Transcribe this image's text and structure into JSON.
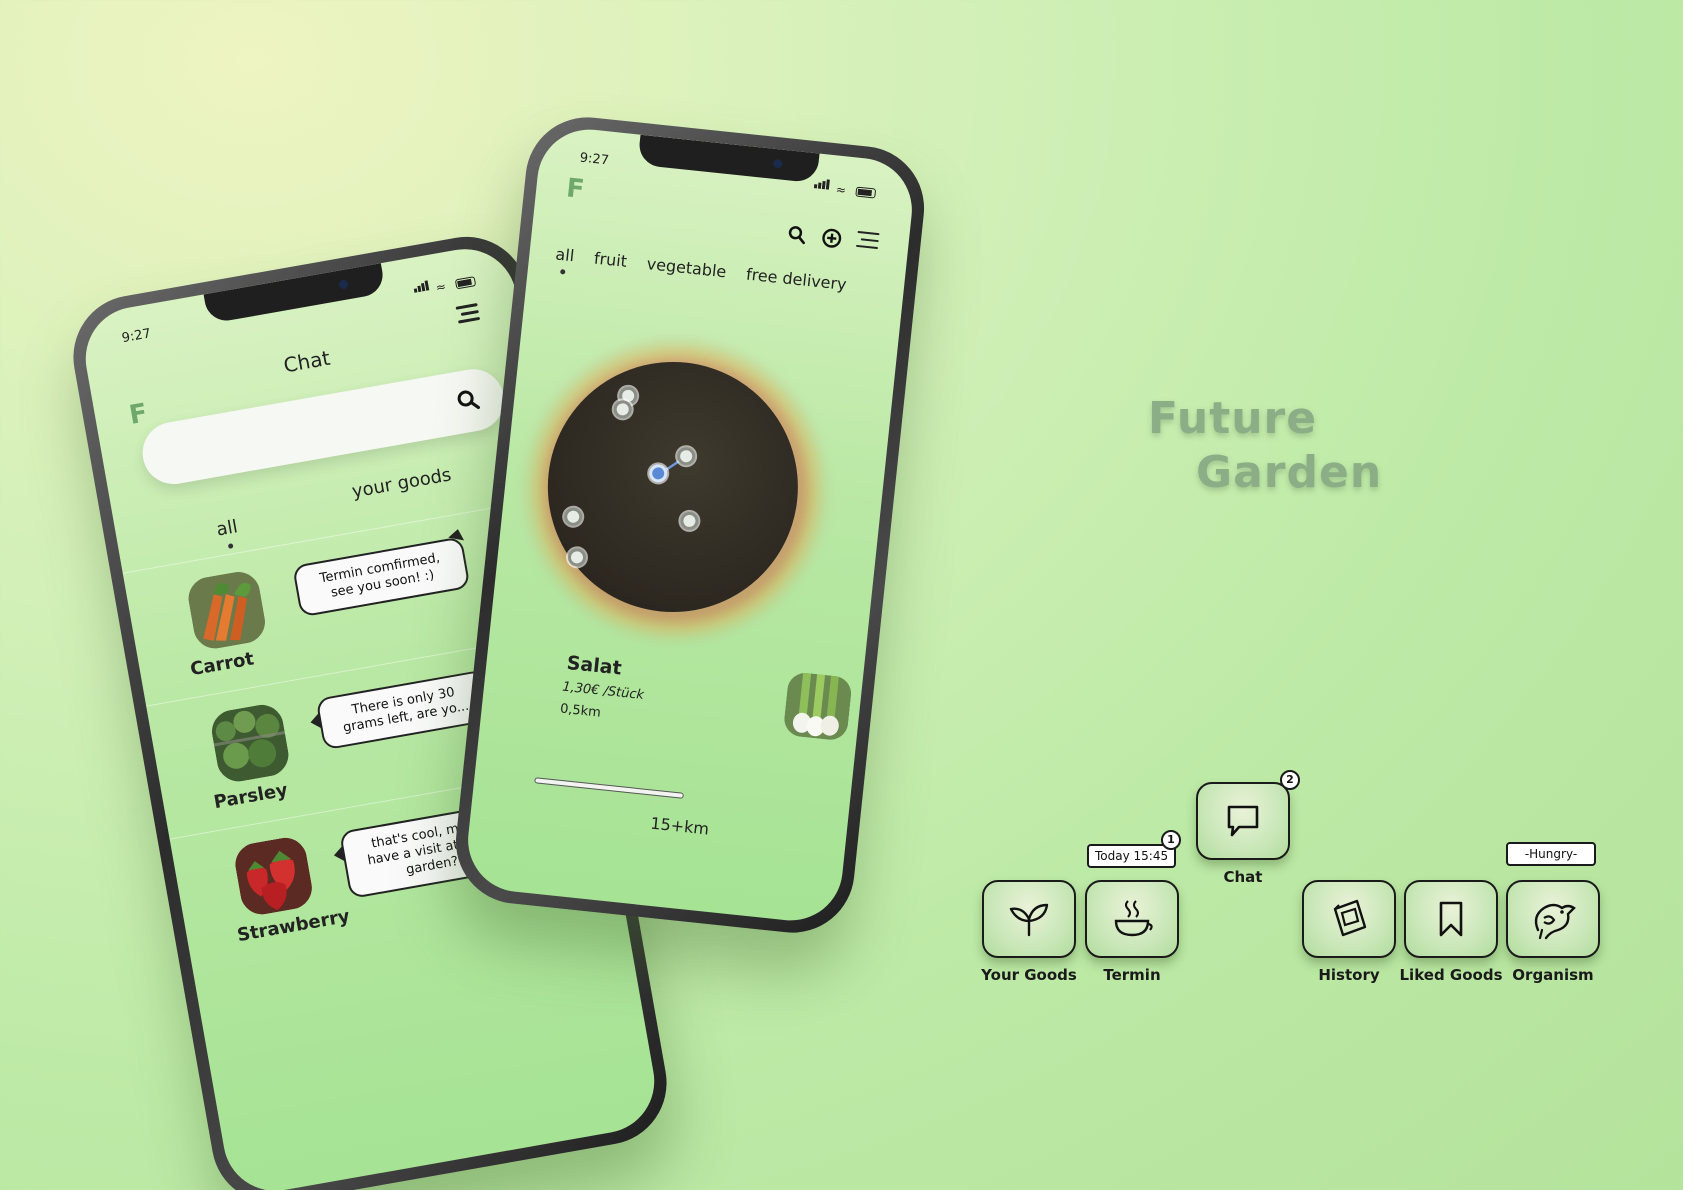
{
  "status": {
    "time": "9:27"
  },
  "brand": {
    "logo_letter": "F",
    "line1": "Future",
    "line2": "Garden"
  },
  "chat_screen": {
    "title": "Chat",
    "search_placeholder": "",
    "tabs": [
      {
        "label": "all",
        "active": true
      },
      {
        "label": "your goods",
        "active": false
      }
    ],
    "conversations": [
      {
        "name": "Carrot",
        "message": "Termin comfirmed, see you soon! :)",
        "thumb": "carrot"
      },
      {
        "name": "Parsley",
        "message": "There is only 30 grams left, are yo...",
        "thumb": "parsley"
      },
      {
        "name": "Strawberry",
        "message": "that's cool, may I have a visit at your garden?",
        "thumb": "strawberry"
      }
    ]
  },
  "map_screen": {
    "icons": [
      "search-icon",
      "add-circle-icon",
      "menu-icon"
    ],
    "categories": [
      {
        "label": "all",
        "active": true
      },
      {
        "label": "fruit",
        "active": false
      },
      {
        "label": "vegetable",
        "active": false
      },
      {
        "label": "free delivery",
        "active": false
      }
    ],
    "product": {
      "name": "Salat",
      "price": "1,30€ /Stück",
      "distance": "0,5km"
    },
    "range_label": "15+km"
  },
  "nav": {
    "your_goods": {
      "label": "Your Goods",
      "icon": "sprout-icon"
    },
    "termin": {
      "label": "Termin",
      "icon": "cup-icon",
      "badge": "1",
      "tag": "Today 15:45"
    },
    "chat": {
      "label": "Chat",
      "icon": "speech-bubble-icon",
      "badge": "2"
    },
    "history": {
      "label": "History",
      "icon": "history-icon"
    },
    "liked_goods": {
      "label": "Liked Goods",
      "icon": "bookmark-icon"
    },
    "organism": {
      "label": "Organism",
      "icon": "bird-icon",
      "tag": "-Hungry-"
    }
  },
  "colors": {
    "accent": "#6fa86b",
    "background": "#bdeaa6",
    "outline": "#1a1a1a"
  }
}
